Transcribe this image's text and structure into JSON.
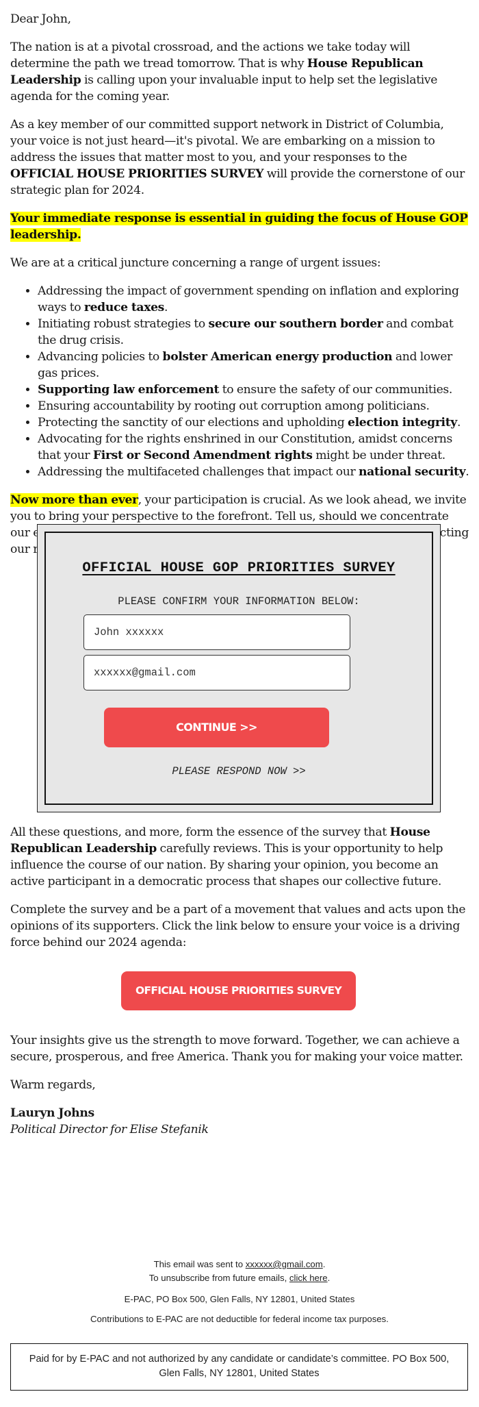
{
  "greeting": "Dear John,",
  "intro": {
    "p1_before": "The nation is at a pivotal crossroad, and the actions we take today will determine the path we tread tomorrow. That is why ",
    "p1_bold": "House Republican Leadership",
    "p1_after": " is calling upon your invaluable input to help set the legislative agenda for the coming year.",
    "p2_before": "As a key member of our committed support network in District of Columbia, your voice is not just heard—it's pivotal. We are embarking on a mission to address the issues that matter most to you, and your responses to the ",
    "p2_bold": "OFFICIAL HOUSE PRIORITIES SURVEY",
    "p2_after": " will provide the cornerstone of our strategic plan for 2024.",
    "highlight": "Your immediate response is essential in guiding the focus of House GOP leadership.",
    "issues_intro": "We are at a critical juncture concerning a range of urgent issues:"
  },
  "issues": [
    {
      "before": "Addressing the impact of government spending on inflation and exploring ways to ",
      "bold": "reduce taxes",
      "after": "."
    },
    {
      "before": "Initiating robust strategies to ",
      "bold": "secure our southern border",
      "after": " and combat the drug crisis."
    },
    {
      "before": "Advancing policies to ",
      "bold": "bolster American energy production",
      "after": " and lower gas prices."
    },
    {
      "before": "",
      "bold": "Supporting law enforcement",
      "after": " to ensure the safety of our communities."
    },
    {
      "before": "Ensuring accountability by rooting out corruption among politicians.",
      "bold": "",
      "after": ""
    },
    {
      "before": "Protecting the sanctity of our elections and upholding ",
      "bold": "election integrity",
      "after": "."
    },
    {
      "before": "Advocating for the rights enshrined in our Constitution, amidst concerns that your ",
      "bold": "First or Second Amendment rights",
      "after": " might be under threat."
    },
    {
      "before": "Addressing the multifaceted challenges that impact our ",
      "bold": "national security",
      "after": "."
    }
  ],
  "now_more": {
    "highlight": "Now more than ever",
    "rest": ", your participation is crucial. As we look ahead, we invite you to bring your perspective to the forefront. Tell us, should we concentrate our efforts on cutting government spending, securing our borders, or protecting our rights?"
  },
  "survey": {
    "title": "OFFICIAL HOUSE GOP PRIORITIES SURVEY",
    "subtitle": "PLEASE CONFIRM YOUR INFORMATION BELOW:",
    "name_value": "John xxxxxx",
    "email_value": "xxxxxx@gmail.com",
    "continue_label": "CONTINUE >>",
    "respond_now": "PLEASE RESPOND NOW >>",
    "accent_color": "#ef4a4c",
    "background_color": "#e7e7e7"
  },
  "body2": {
    "p1_before": "All these questions, and more, form the essence of the survey that ",
    "p1_bold": "House Republican Leadership",
    "p1_after": " carefully reviews. This is your opportunity to help influence the course of our nation. By sharing your opinion, you become an active participant in a democratic process that shapes our collective future.",
    "p2": "Complete the survey and be a part of a movement that values and acts upon the opinions of its supporters. Click the link below to ensure your voice is a driving force behind our 2024 agenda:"
  },
  "cta_label": "OFFICIAL HOUSE PRIORITIES SURVEY",
  "closing": {
    "p1": "Your insights give us the strength to move forward. Together, we can achieve a secure, prosperous, and free America. Thank you for making your voice matter.",
    "signoff": "Warm regards,",
    "sig_name": "Lauryn Johns",
    "sig_title": "Political Director for Elise Stefanik"
  },
  "footer": {
    "sent_to_prefix": "This email was sent to ",
    "sent_to_email": "xxxxxx@gmail.com",
    "sent_to_suffix": ".",
    "unsub_prefix": "To unsubscribe from future emails, ",
    "unsub_link": "click here",
    "unsub_suffix": ".",
    "address": "E-PAC, PO Box 500, Glen Falls, NY 12801, United States",
    "tax_notice": "Contributions to E-PAC are not deductible for federal income tax purposes.",
    "paid_for": "Paid for by E-PAC and not authorized by any candidate or candidate’s committee. PO Box 500, Glen Falls, NY 12801, United States"
  },
  "colors": {
    "highlight": "#ffff00",
    "button": "#ef4a4c",
    "text": "#1a1a1a"
  }
}
